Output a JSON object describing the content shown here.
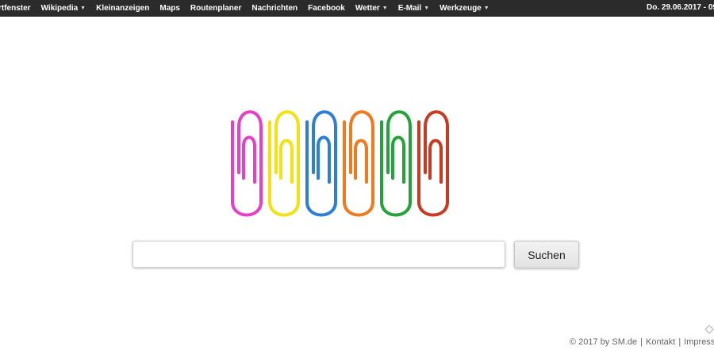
{
  "topbar": {
    "items": [
      {
        "label": "rtfenster",
        "dropdown": false
      },
      {
        "label": "Wikipedia",
        "dropdown": true
      },
      {
        "label": "Kleinanzeigen",
        "dropdown": false
      },
      {
        "label": "Maps",
        "dropdown": false
      },
      {
        "label": "Routenplaner",
        "dropdown": false
      },
      {
        "label": "Nachrichten",
        "dropdown": false
      },
      {
        "label": "Facebook",
        "dropdown": false
      },
      {
        "label": "Wetter",
        "dropdown": true
      },
      {
        "label": "E-Mail",
        "dropdown": true
      },
      {
        "label": "Werkzeuge",
        "dropdown": true
      }
    ],
    "caret": "▼",
    "date": "Do. 29.06.2017 - 09"
  },
  "logo": {
    "clip_colors": [
      "#e83fc8",
      "#f3e210",
      "#2a7fd6",
      "#f07a1e",
      "#22a43a",
      "#c83a22"
    ]
  },
  "search": {
    "value": "",
    "placeholder": "",
    "button_label": "Suchen"
  },
  "footer": {
    "copyright": "© 2017 by SM.de",
    "contact": "Kontakt",
    "imprint": "Impress",
    "separator": "|"
  }
}
